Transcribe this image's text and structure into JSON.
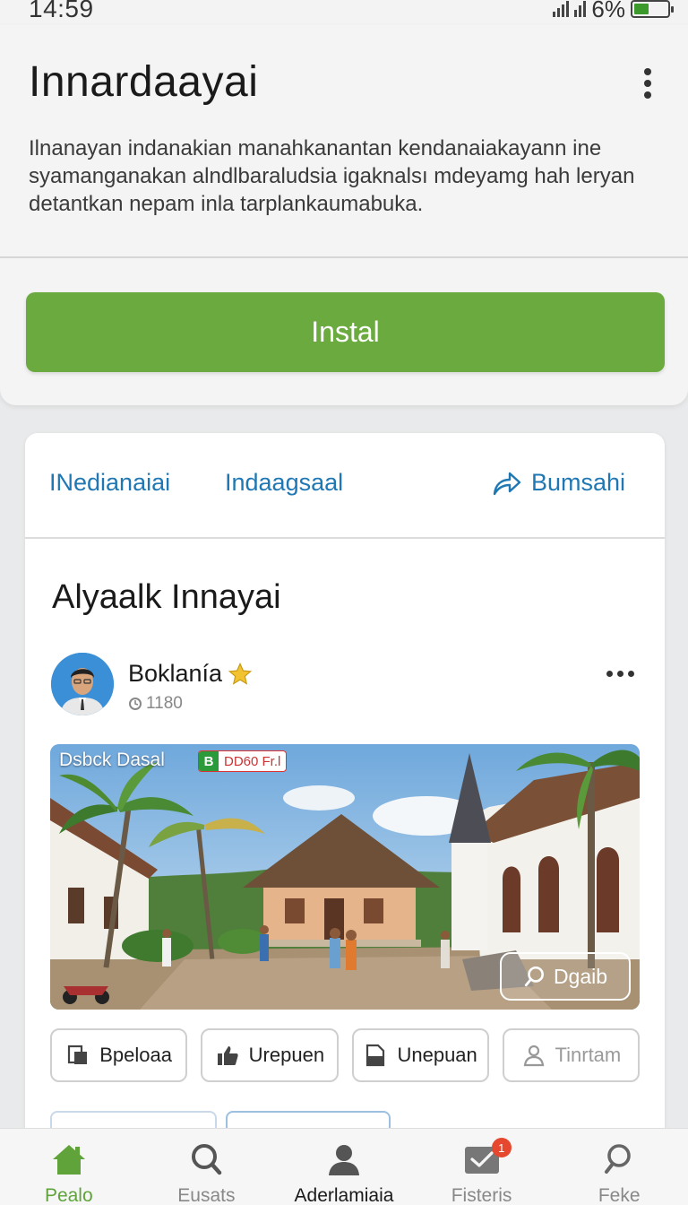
{
  "status_bar": {
    "time": "14:59",
    "battery_percent": "6%",
    "battery_level": 0.45
  },
  "header": {
    "title": "Innardaayai",
    "description": "Ilnanayan indanakian manahkanantan kendanaiakayann ine syamanganakan alndlbaraludsia igaknalsı mdeyamg hah leryan detantkan nepam inla tarplankaumabuka.",
    "install_label": "Instal",
    "accent_color": "#6aaa3f"
  },
  "tabs": [
    {
      "label": "INedianaiai"
    },
    {
      "label": "Indaagsaal"
    },
    {
      "label": "Bumsahi",
      "icon": "share-icon"
    }
  ],
  "post": {
    "section_title": "Alyaalk Innayai",
    "author": {
      "name": "Boklanía",
      "badge_icon": "star-icon",
      "meta": "1180"
    },
    "image": {
      "label": "Dsbck Dasal",
      "badge_text": "DD60 Fr.l",
      "badge_icon_letter": "B",
      "details_label": "Dgaib"
    },
    "actions": [
      {
        "label": "Bpeloaa",
        "icon": "bookmark-icon"
      },
      {
        "label": "Urepuen",
        "icon": "thumbs-up-icon"
      },
      {
        "label": "Unepuan",
        "icon": "document-icon"
      },
      {
        "label": "Tinrtam",
        "icon": "user-icon"
      }
    ]
  },
  "bottom_nav": [
    {
      "label": "Pealo",
      "icon": "home-icon",
      "active": true
    },
    {
      "label": "Eusats",
      "icon": "search-icon"
    },
    {
      "label": "Aderlamiaia",
      "icon": "profile-icon"
    },
    {
      "label": "Fisteris",
      "icon": "mail-icon",
      "badge": "1"
    },
    {
      "label": "Feke",
      "icon": "search-icon"
    }
  ]
}
